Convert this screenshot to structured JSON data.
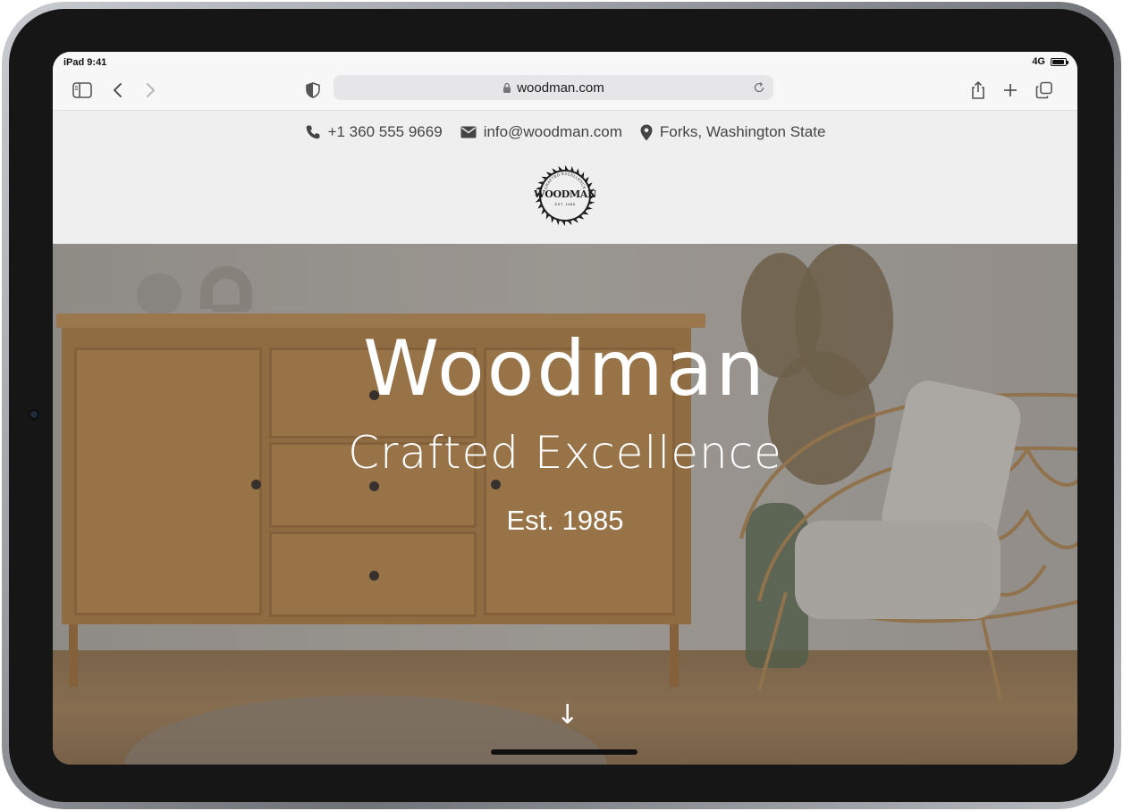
{
  "status_bar": {
    "left": "iPad 9:41",
    "network": "4G",
    "battery_level": 0.9
  },
  "browser": {
    "url": "woodman.com",
    "icons": [
      "sidebar-icon",
      "back-icon",
      "forward-icon",
      "privacy-shield-icon",
      "lock-icon",
      "reload-icon",
      "share-icon",
      "new-tab-icon",
      "tabs-icon"
    ]
  },
  "contact_bar": {
    "phone": "+1 360 555 9669",
    "email": "info@woodman.com",
    "location": "Forks, Washington State"
  },
  "logo": {
    "word": "WOODMAN",
    "tagline": "CRAFTED EXCELLENCE",
    "est": "EST. 1985"
  },
  "hero": {
    "title": "Woodman",
    "subtitle": "Crafted Excellence",
    "est": "Est. 1985",
    "scroll_arrow": "↓"
  },
  "colors": {
    "topbar_bg": "#efefef",
    "hero_text": "#ffffff",
    "contact_text": "#444444"
  }
}
